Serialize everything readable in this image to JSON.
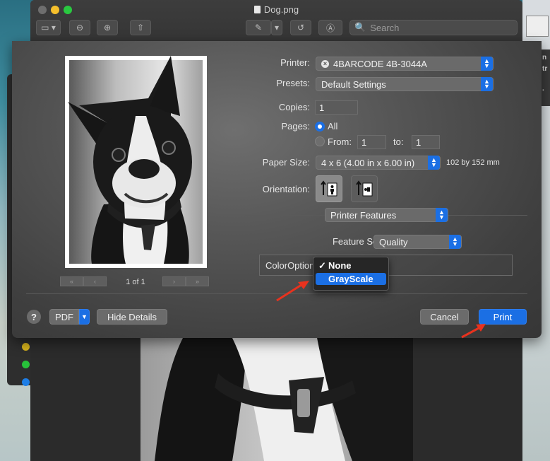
{
  "window": {
    "title": "Dog.png",
    "search_placeholder": "Search",
    "toolbar_icons": [
      "sidebar-icon",
      "zoom-out-icon",
      "zoom-in-icon",
      "share-icon",
      "markup-pen-icon",
      "rotate-icon",
      "annotate-icon"
    ]
  },
  "print": {
    "printer_label": "Printer:",
    "printer_value": "4BARCODE 4B-3044A",
    "presets_label": "Presets:",
    "presets_value": "Default Settings",
    "copies_label": "Copies:",
    "copies_value": "1",
    "pages_label": "Pages:",
    "pages_all": "All",
    "pages_from_label": "From:",
    "pages_from_value": "1",
    "pages_to_label": "to:",
    "pages_to_value": "1",
    "paper_size_label": "Paper Size:",
    "paper_size_value": "4 x 6 (4.00 in x 6.00 in)",
    "paper_size_dims": "102 by 152 mm",
    "orientation_label": "Orientation:",
    "section_popup": "Printer Features",
    "feature_sets_label": "Feature Sets:",
    "feature_sets_value": "Quality",
    "color_option_label": "ColorOption",
    "color_menu": {
      "items": [
        "None",
        "GrayScale"
      ],
      "checked": "None",
      "highlighted": "GrayScale"
    },
    "page_indicator": "1 of 1",
    "help_label": "?",
    "pdf_label": "PDF",
    "hide_details_label": "Hide Details",
    "cancel_label": "Cancel",
    "print_label": "Print"
  },
  "colors": {
    "accent": "#1b6fe4",
    "annotation_arrow": "#e8321e"
  }
}
